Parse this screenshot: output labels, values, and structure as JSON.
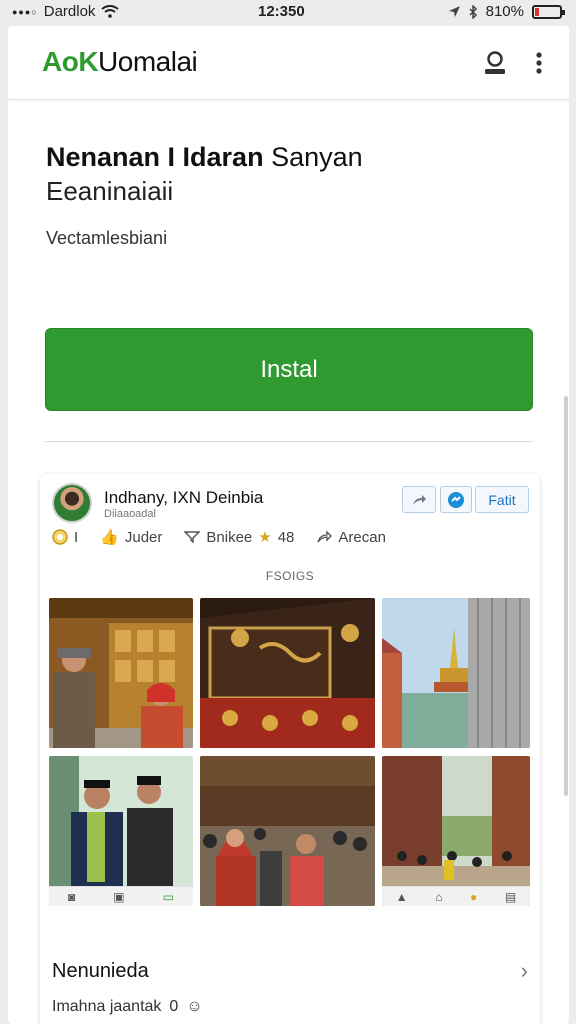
{
  "status_bar": {
    "carrier": "Dardlok",
    "time": "12:350",
    "battery": "810%",
    "battery_level": 0.15
  },
  "app_bar": {
    "brand_green": "AoK",
    "brand_dark": "Uomalai"
  },
  "header": {
    "title_bold": "Nenanan I Idaran",
    "title_regular": "Sanyan",
    "title_line2": "Eeaninaiaii",
    "subtitle": "Vectamlesbiani"
  },
  "install_button": {
    "label": "Instal"
  },
  "post": {
    "author": "Indhany, IXN Deinbia",
    "meta": "Diiaaoadal",
    "follow_label": "Fatit",
    "reactions": [
      {
        "icon": "badge-icon",
        "label": "I"
      },
      {
        "icon": "thumb-icon",
        "label": "Juder"
      },
      {
        "icon": "bookmark-icon",
        "label": "Bnikee",
        "extra": "48"
      },
      {
        "icon": "share-arrow-icon",
        "label": "Arecan"
      }
    ],
    "section_label": "FSOIGS"
  },
  "more": {
    "title": "Nenunieda",
    "footer_text": "Imahna jaantak",
    "footer_num": "0"
  }
}
